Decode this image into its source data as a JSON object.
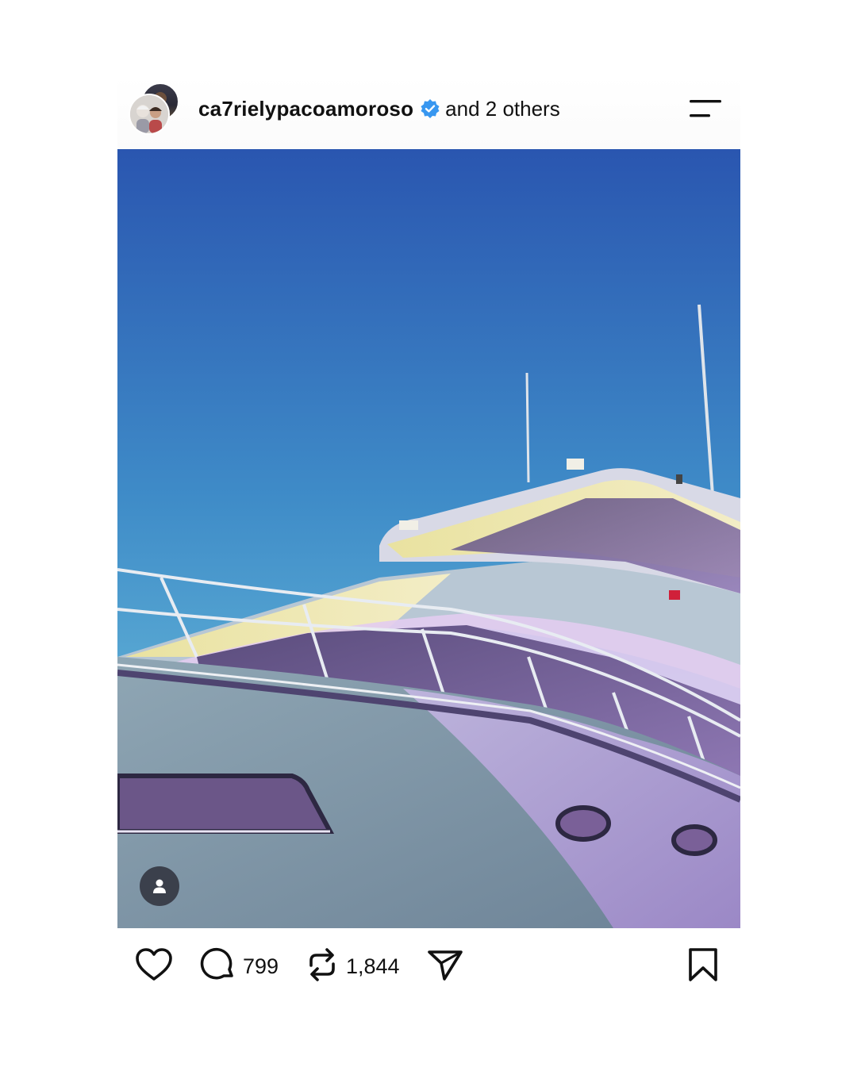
{
  "post": {
    "author": {
      "username": "ca7rielypacoamoroso",
      "verified": true,
      "coauthors_text": "and 2 others"
    },
    "image": {
      "description_icon": "tagged-people-icon"
    },
    "actions": {
      "like_icon": "heart-icon",
      "comment_icon": "comment-icon",
      "comment_count": "799",
      "repost_icon": "repost-icon",
      "repost_count": "1,844",
      "share_icon": "send-icon",
      "save_icon": "bookmark-icon"
    },
    "menu_icon": "menu-icon"
  },
  "colors": {
    "verified_badge": "#3897f0",
    "text": "#111111",
    "sky_top": "#2a56b0",
    "sky_bottom": "#6fc3dc",
    "hull_purple": "#a89ac8"
  }
}
